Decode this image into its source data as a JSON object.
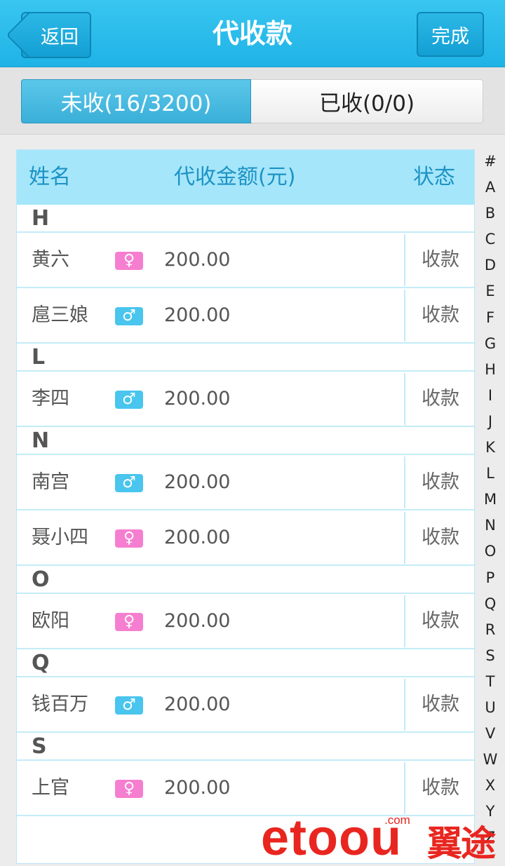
{
  "header": {
    "back_label": "返回",
    "title": "代收款",
    "done_label": "完成"
  },
  "tabs": [
    {
      "label": "未收(16/3200)",
      "active": true
    },
    {
      "label": "已收(0/0)",
      "active": false
    }
  ],
  "table": {
    "col_name": "姓名",
    "col_amount": "代收金额(元)",
    "col_status": "状态",
    "sections": [
      {
        "letter": "H",
        "rows": [
          {
            "name": "黄六",
            "gender": "female",
            "gender_icon": "♀",
            "amount": "200.00",
            "action": "收款"
          },
          {
            "name": "扈三娘",
            "gender": "male",
            "gender_icon": "♂",
            "amount": "200.00",
            "action": "收款"
          }
        ]
      },
      {
        "letter": "L",
        "rows": [
          {
            "name": "李四",
            "gender": "male",
            "gender_icon": "♂",
            "amount": "200.00",
            "action": "收款"
          }
        ]
      },
      {
        "letter": "N",
        "rows": [
          {
            "name": "南宫",
            "gender": "male",
            "gender_icon": "♂",
            "amount": "200.00",
            "action": "收款"
          },
          {
            "name": "聂小四",
            "gender": "female",
            "gender_icon": "♀",
            "amount": "200.00",
            "action": "收款"
          }
        ]
      },
      {
        "letter": "O",
        "rows": [
          {
            "name": "欧阳",
            "gender": "female",
            "gender_icon": "♀",
            "amount": "200.00",
            "action": "收款"
          }
        ]
      },
      {
        "letter": "Q",
        "rows": [
          {
            "name": "钱百万",
            "gender": "male",
            "gender_icon": "♂",
            "amount": "200.00",
            "action": "收款"
          }
        ]
      },
      {
        "letter": "S",
        "rows": [
          {
            "name": "上官",
            "gender": "female",
            "gender_icon": "♀",
            "amount": "200.00",
            "action": "收款"
          }
        ]
      }
    ]
  },
  "index_letters": [
    "#",
    "A",
    "B",
    "C",
    "D",
    "E",
    "F",
    "G",
    "H",
    "I",
    "J",
    "K",
    "L",
    "M",
    "N",
    "O",
    "P",
    "Q",
    "R",
    "S",
    "T",
    "U",
    "V",
    "W",
    "X",
    "Y",
    "Z"
  ],
  "watermark": {
    "logo": "etoou",
    "com": ".com",
    "cn": "翼途"
  },
  "colors": {
    "header": "#1fb3e6",
    "table_head": "#a6e6fb",
    "female": "#f67ed0",
    "male": "#49c5ee",
    "watermark": "#e8261f"
  }
}
